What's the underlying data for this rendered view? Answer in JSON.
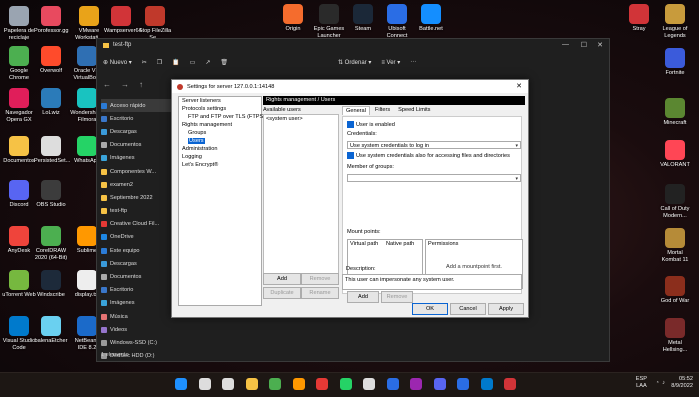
{
  "desktop_left": [
    {
      "label": "Papelera de reciclaje",
      "color": "#9aa4b1"
    },
    {
      "label": "Porofessor.gg",
      "color": "#e84a5f"
    },
    {
      "label": "VMware Workstati...",
      "color": "#e9a319"
    },
    {
      "label": "Wampserver64",
      "color": "#d13438"
    },
    {
      "label": "Stop FileZilla Se...",
      "color": "#c0392b"
    },
    {
      "label": "Google Chrome",
      "color": "#4caf50"
    },
    {
      "label": "Overwolf",
      "color": "#ff4b2b"
    },
    {
      "label": "Oracle VM VirtualBo...",
      "color": "#2f6fb3"
    },
    {
      "label": "Navegador Opera GX",
      "color": "#e01e5a"
    },
    {
      "label": "LoLwiz",
      "color": "#2b7bb9"
    },
    {
      "label": "Wondershare Filmora",
      "color": "#19c3c0"
    },
    {
      "label": "Documentos",
      "color": "#f6c245"
    },
    {
      "label": "PersistedSet...",
      "color": "#dddddd"
    },
    {
      "label": "WhatsApp",
      "color": "#25d366"
    },
    {
      "label": "Discord",
      "color": "#5865f2"
    },
    {
      "label": "OBS Studio",
      "color": "#3c3c3c"
    },
    {
      "label": "AnyDesk",
      "color": "#ef443b"
    },
    {
      "label": "CorelDRAW 2020 (64-Bit)",
      "color": "#4caf50"
    },
    {
      "label": "Sublime",
      "color": "#ff9800"
    },
    {
      "label": "uTorrent Web",
      "color": "#76b83f"
    },
    {
      "label": "Windscribe",
      "color": "#1d2a3a"
    },
    {
      "label": "display.txt",
      "color": "#eeeeee"
    },
    {
      "label": "Visual Studio Code",
      "color": "#007acc"
    },
    {
      "label": "balenaEtcher",
      "color": "#6ad0f0"
    },
    {
      "label": "NetBeans IDE 8.2",
      "color": "#1b6ac9"
    }
  ],
  "desktop_top": [
    {
      "label": "Origin",
      "color": "#f56c2d"
    },
    {
      "label": "Epic Games Launcher",
      "color": "#2a2a2a",
      "badge": "EPIC GAMES"
    },
    {
      "label": "Steam",
      "color": "#1b2838"
    },
    {
      "label": "Ubisoft Connect",
      "color": "#2a6de5"
    },
    {
      "label": "Battle.net",
      "color": "#148eff"
    }
  ],
  "desktop_right": [
    {
      "label": "Stray",
      "color": "#d13438"
    },
    {
      "label": "League of Legends",
      "color": "#c89b3c"
    },
    {
      "label": "Fortnite",
      "color": "#3b5bdb"
    },
    {
      "label": "Minecraft",
      "color": "#5b8731"
    },
    {
      "label": "VALORANT",
      "color": "#ff4655"
    },
    {
      "label": "Call of Duty Modern...",
      "color": "#222222"
    },
    {
      "label": "Mortal Kombat 11",
      "color": "#b68b38"
    },
    {
      "label": "God of War",
      "color": "#8b2e1c"
    },
    {
      "label": "Metal Hellsing...",
      "color": "#7a2a2a"
    }
  ],
  "explorer": {
    "title": "test-ftp",
    "toolbar": {
      "new": "Nuevo",
      "order": "Ordenar",
      "view": "Ver"
    },
    "nav": [
      {
        "label": "Acceso rápido",
        "color": "#2b7bd6",
        "selected": true
      },
      {
        "label": "Escritorio",
        "color": "#3a77c9"
      },
      {
        "label": "Descargas",
        "color": "#3a9ad9"
      },
      {
        "label": "Documentos",
        "color": "#aaaaaa"
      },
      {
        "label": "Imágenes",
        "color": "#3aa3d9"
      },
      {
        "label": "Componentes W...",
        "color": "#f6c245"
      },
      {
        "label": "examen2",
        "color": "#f6c245"
      },
      {
        "label": "Septiembre 2022",
        "color": "#f6c245"
      },
      {
        "label": "test-ftp",
        "color": "#f6c245"
      },
      {
        "label": "Creative Cloud Fil...",
        "color": "#e53935"
      },
      {
        "label": "OneDrive",
        "color": "#1e88e5"
      },
      {
        "label": "Este equipo",
        "color": "#2b7bd6"
      },
      {
        "label": "Descargas",
        "color": "#3a9ad9"
      },
      {
        "label": "Documentos",
        "color": "#aaaaaa"
      },
      {
        "label": "Escritorio",
        "color": "#3a77c9"
      },
      {
        "label": "Imágenes",
        "color": "#3aa3d9"
      },
      {
        "label": "Música",
        "color": "#e57373"
      },
      {
        "label": "Videos",
        "color": "#9575cd"
      },
      {
        "label": "Windows-SSD (C:)",
        "color": "#999999"
      },
      {
        "label": "DedSec HDD (D:)",
        "color": "#999999"
      }
    ],
    "status": "1 elemento"
  },
  "dialog": {
    "title": "Settings for server 127.0.0.1:14148",
    "tree": [
      {
        "label": "Server listeners",
        "indent": 0
      },
      {
        "label": "Protocols settings",
        "indent": 0
      },
      {
        "label": "FTP and FTP over TLS (FTPS)",
        "indent": 1
      },
      {
        "label": "Rights management",
        "indent": 0
      },
      {
        "label": "Groups",
        "indent": 1
      },
      {
        "label": "Users",
        "indent": 1,
        "selected": true
      },
      {
        "label": "Administration",
        "indent": 0
      },
      {
        "label": "Logging",
        "indent": 0
      },
      {
        "label": "Let's Encrypt®",
        "indent": 0
      }
    ],
    "section_header": "Rights management / Users",
    "available_users_label": "Available users",
    "users": [
      "<system user>"
    ],
    "buttons": {
      "add": "Add",
      "remove": "Remove",
      "duplicate": "Duplicate",
      "rename": "Rename"
    },
    "tabs": [
      "General",
      "Filters",
      "Speed Limits"
    ],
    "user_enabled_label": "User is enabled",
    "credentials_label": "Credentials:",
    "credentials_value": "Use system credentials to log in",
    "impersonation_label": "Use system credentials also for accessing files and directories",
    "member_of_groups_label": "Member of groups:",
    "mount_points_label": "Mount points:",
    "virtual_path_header": "Virtual path",
    "native_path_header": "Native path",
    "permissions_header": "Permissions",
    "permissions_placeholder": "Add a mountpoint first.",
    "mount_add": "Add",
    "mount_remove": "Remove",
    "description_label": "Description:",
    "description_text": "This user can impersonate any system user.",
    "ok": "OK",
    "cancel": "Cancel",
    "apply": "Apply"
  },
  "taskbar": {
    "icons": [
      "#1e90ff",
      "#dddddd",
      "#dddddd",
      "#f6c245",
      "#4caf50",
      "#ff9800",
      "#e53935",
      "#25d366",
      "#dddddd",
      "#2a6de5",
      "#9c27b0",
      "#5865f2",
      "#2a6de5",
      "#007acc",
      "#d13438"
    ],
    "lang": "ESP",
    "layout": "LAA",
    "time": "05:52",
    "date": "8/9/2022"
  }
}
